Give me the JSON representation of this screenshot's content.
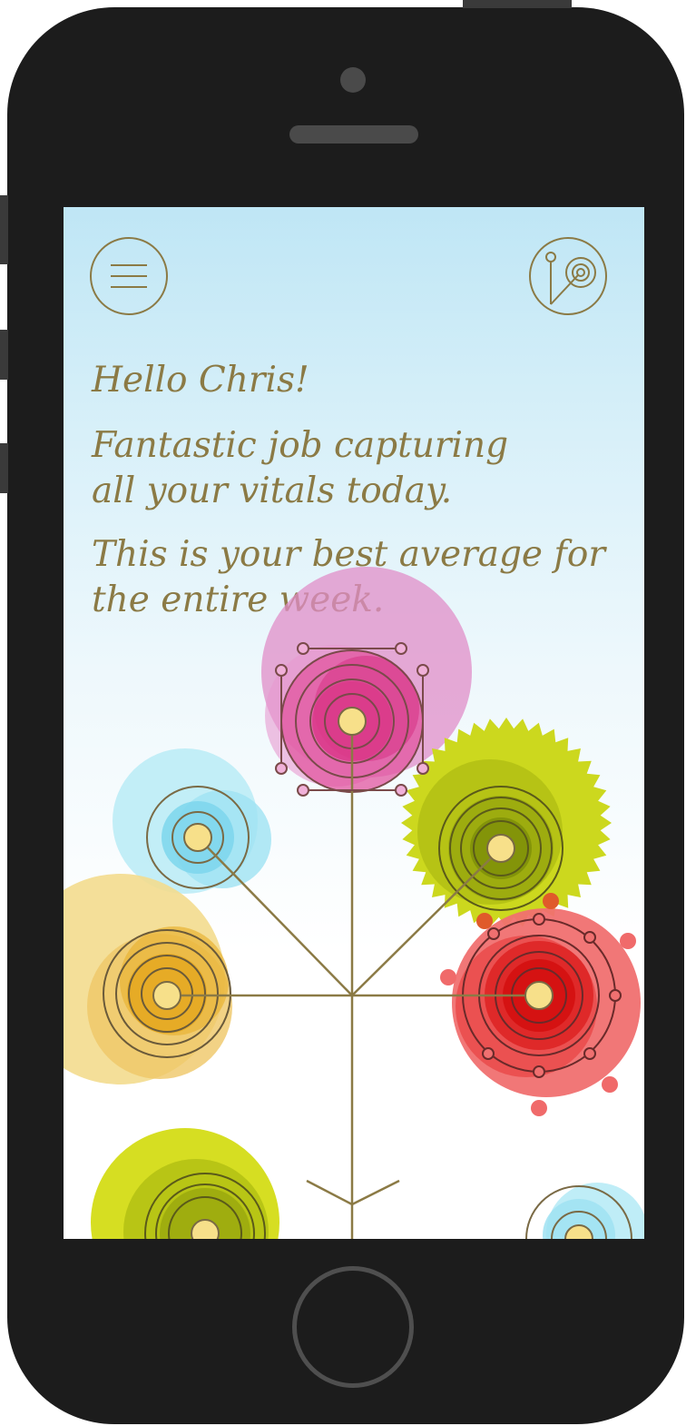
{
  "greeting": "Hello Chris!",
  "praise_line_1": "Fantastic job capturing",
  "praise_line_2": "all your vitals today.",
  "average_line_1": "This is your best average for",
  "average_line_2": "the entire week.",
  "icons": {
    "menu": "hamburger-menu-icon",
    "logo": "vitals-logo-icon"
  },
  "colors": {
    "text": "#8b7a45",
    "magenta": "#e0399a",
    "cyan": "#7fd7ea",
    "lime": "#c8d61e",
    "olive": "#8c9a10",
    "amber": "#e8a91e",
    "red": "#e2141a",
    "center": "#f7e08a"
  }
}
